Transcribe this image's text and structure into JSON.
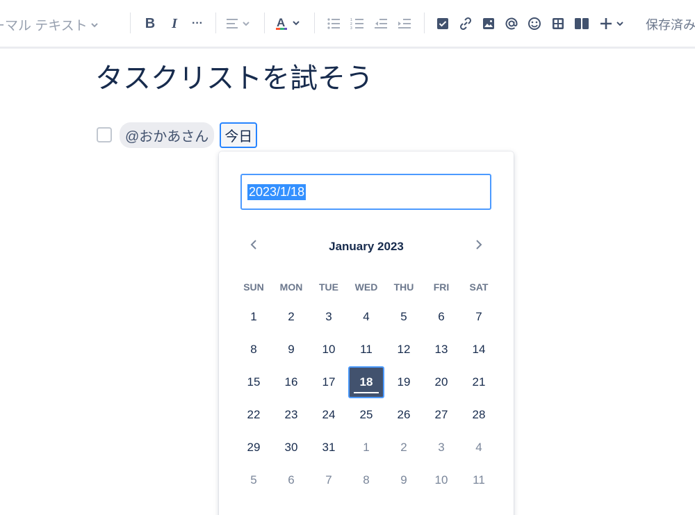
{
  "toolbar": {
    "text_style_label": "ーマル テキスト",
    "bold_label": "B",
    "italic_label": "I",
    "more_label": "···",
    "save_status": "保存済み"
  },
  "page": {
    "title": "タスクリストを試そう"
  },
  "task": {
    "mention": "@おかあさん",
    "date_chip": "今日",
    "checked": false
  },
  "datepicker": {
    "input_value": "2023/1/18",
    "month_title": "January 2023",
    "weekdays": [
      "SUN",
      "MON",
      "TUE",
      "WED",
      "THU",
      "FRI",
      "SAT"
    ],
    "weeks": [
      [
        "1",
        "2",
        "3",
        "4",
        "5",
        "6",
        "7"
      ],
      [
        "8",
        "9",
        "10",
        "11",
        "12",
        "13",
        "14"
      ],
      [
        "15",
        "16",
        "17",
        "18",
        "19",
        "20",
        "21"
      ],
      [
        "22",
        "23",
        "24",
        "25",
        "26",
        "27",
        "28"
      ],
      [
        "29",
        "30",
        "31",
        "1",
        "2",
        "3",
        "4"
      ],
      [
        "5",
        "6",
        "7",
        "8",
        "9",
        "10",
        "11"
      ]
    ],
    "selected_day": "18"
  },
  "colors": {
    "accent": "#4c9aff",
    "selected_bg": "#42526e",
    "text": "#172b4d"
  }
}
